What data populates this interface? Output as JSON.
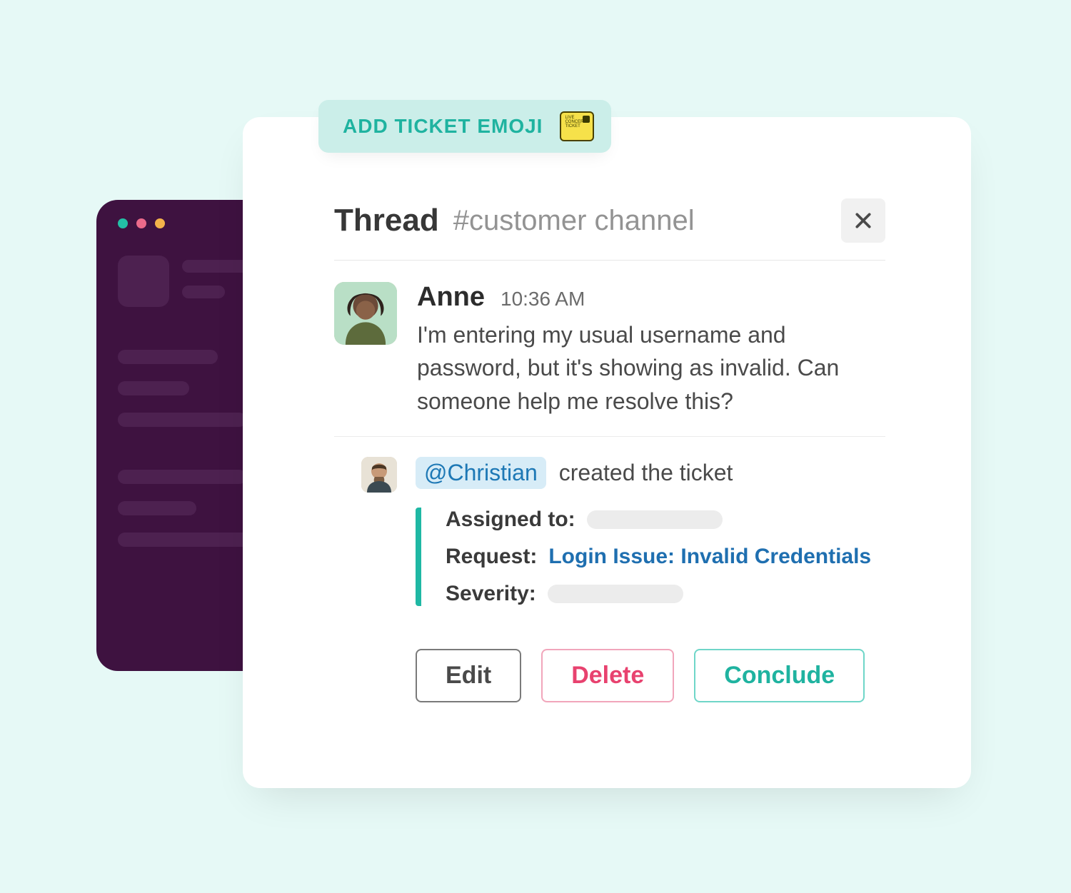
{
  "tag": {
    "label": "ADD TICKET EMOJI"
  },
  "thread": {
    "title": "Thread",
    "channel": "#customer channel"
  },
  "message": {
    "author": "Anne",
    "time": "10:36 AM",
    "text": "I'm entering my usual username and password, but it's showing as invalid. Can someone help me resolve this?"
  },
  "reply": {
    "mention": "@Christian",
    "action_text": "created the ticket"
  },
  "ticket": {
    "assigned_label": "Assigned to:",
    "request_label": "Request:",
    "request_value": "Login Issue: Invalid Credentials",
    "severity_label": "Severity:"
  },
  "buttons": {
    "edit": "Edit",
    "delete": "Delete",
    "conclude": "Conclude"
  }
}
